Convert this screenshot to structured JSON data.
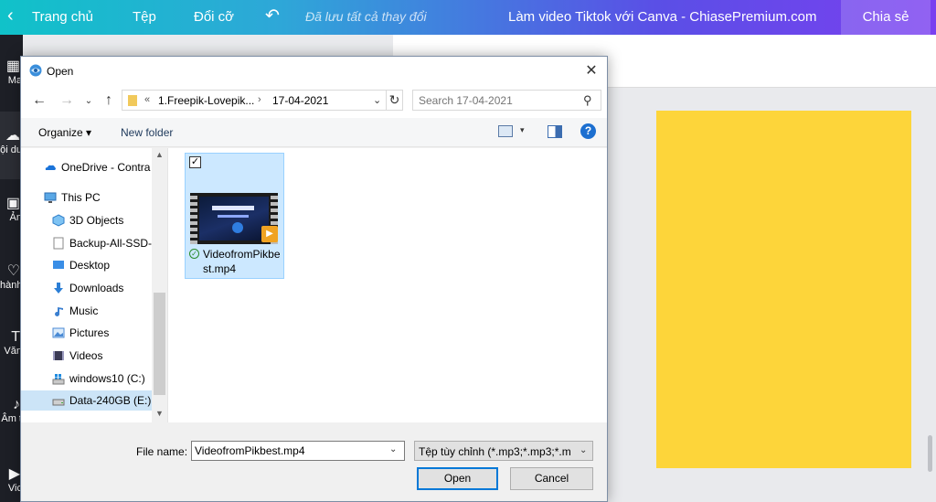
{
  "canva": {
    "topbar": {
      "home": "Trang chủ",
      "file": "Tệp",
      "resize": "Đổi cỡ",
      "saved_status": "Đã lưu tất cả thay đổi",
      "doc_title": "Làm video Tiktok với Canva - ChiasePremium.com",
      "share": "Chia sẻ"
    },
    "sidebar": {
      "items": [
        {
          "label": "Ma",
          "icon": "template-icon"
        },
        {
          "label": "ội du",
          "icon": "upload-icon"
        },
        {
          "label": "Ản",
          "icon": "photo-icon"
        },
        {
          "label": "hành",
          "icon": "elements-icon"
        },
        {
          "label": "Văn",
          "icon": "text-icon"
        },
        {
          "label": "Âm t",
          "icon": "audio-icon"
        },
        {
          "label": "Vic",
          "icon": "video-icon"
        }
      ]
    },
    "page_color": "#fdd53a"
  },
  "dialog": {
    "title": "Open",
    "close": "✕",
    "address": {
      "overflow": "«",
      "segments": [
        "1.Freepik-Lovepik...",
        "17-04-2021"
      ],
      "separator": "›"
    },
    "search_placeholder": "Search 17-04-2021",
    "commands": {
      "organize": "Organize ▾",
      "new_folder": "New folder",
      "help": "?"
    },
    "nav_items": [
      {
        "label": "OneDrive - Contra",
        "icon": "onedrive-icon",
        "indent": 1,
        "selected": false
      },
      {
        "label": "This PC",
        "icon": "this-pc-icon",
        "indent": 1,
        "selected": false
      },
      {
        "label": "3D Objects",
        "icon": "3d-objects-icon",
        "indent": 2,
        "selected": false
      },
      {
        "label": "Backup-All-SSD-",
        "icon": "file-icon",
        "indent": 2,
        "selected": false
      },
      {
        "label": "Desktop",
        "icon": "desktop-icon",
        "indent": 2,
        "selected": false
      },
      {
        "label": "Downloads",
        "icon": "downloads-icon",
        "indent": 2,
        "selected": false
      },
      {
        "label": "Music",
        "icon": "music-icon",
        "indent": 2,
        "selected": false
      },
      {
        "label": "Pictures",
        "icon": "pictures-icon",
        "indent": 2,
        "selected": false
      },
      {
        "label": "Videos",
        "icon": "videos-icon",
        "indent": 2,
        "selected": false
      },
      {
        "label": "windows10 (C:)",
        "icon": "windows-drive-icon",
        "indent": 2,
        "selected": false
      },
      {
        "label": "Data-240GB (E:)",
        "icon": "drive-icon",
        "indent": 2,
        "selected": true
      }
    ],
    "file": {
      "name": "VideofromPikbest.mp4",
      "checked": "✓"
    },
    "filename_label": "File name:",
    "filename_value": "VideofromPikbest.mp4",
    "filetype_value": "Tệp tùy chỉnh (*.mp3;*.mp3;*.m",
    "open_label": "Open",
    "cancel_label": "Cancel"
  }
}
